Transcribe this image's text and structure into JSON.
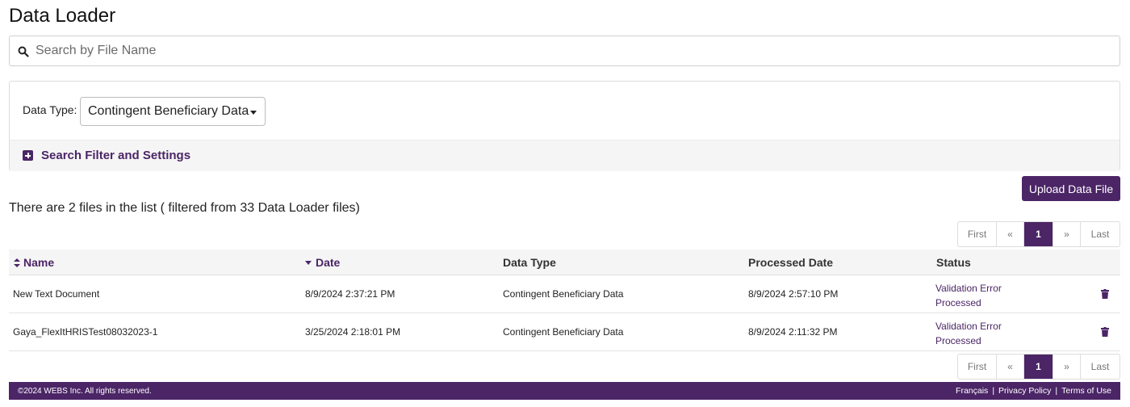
{
  "page": {
    "title": "Data Loader"
  },
  "search": {
    "placeholder": "Search by File Name",
    "value": ""
  },
  "filter": {
    "data_type_label": "Data Type:",
    "data_type_value": "Contingent Beneficiary Data",
    "settings_label": "Search Filter and Settings"
  },
  "actions": {
    "upload_label": "Upload Data File"
  },
  "summary": {
    "text": "There are 2 files in the list ( filtered from 33 Data Loader files)"
  },
  "pagination": {
    "first": "First",
    "prev": "«",
    "current": "1",
    "next": "»",
    "last": "Last"
  },
  "table": {
    "headers": {
      "name": "Name",
      "date": "Date",
      "data_type": "Data Type",
      "processed_date": "Processed Date",
      "status": "Status"
    },
    "rows": [
      {
        "name": "New Text Document",
        "date": "8/9/2024 2:37:21 PM",
        "data_type": "Contingent Beneficiary Data",
        "processed_date": "8/9/2024 2:57:10 PM",
        "status_line1": "Validation Error",
        "status_line2": "Processed"
      },
      {
        "name": "Gaya_FlexItHRISTest08032023-1",
        "date": "3/25/2024 2:18:01 PM",
        "data_type": "Contingent Beneficiary Data",
        "processed_date": "8/9/2024 2:11:32 PM",
        "status_line1": "Validation Error",
        "status_line2": "Processed"
      }
    ]
  },
  "footer": {
    "copyright": "©2024 WEBS Inc. All rights reserved.",
    "links": [
      "Français",
      "Privacy Policy",
      "Terms of Use"
    ],
    "separator": "|"
  },
  "colors": {
    "brand": "#4b2566",
    "header_bg": "#f5f5f5"
  },
  "icons": {
    "search": "search-icon",
    "expand": "plus-square-icon",
    "delete": "trash-icon",
    "sort": "sort-icon"
  }
}
